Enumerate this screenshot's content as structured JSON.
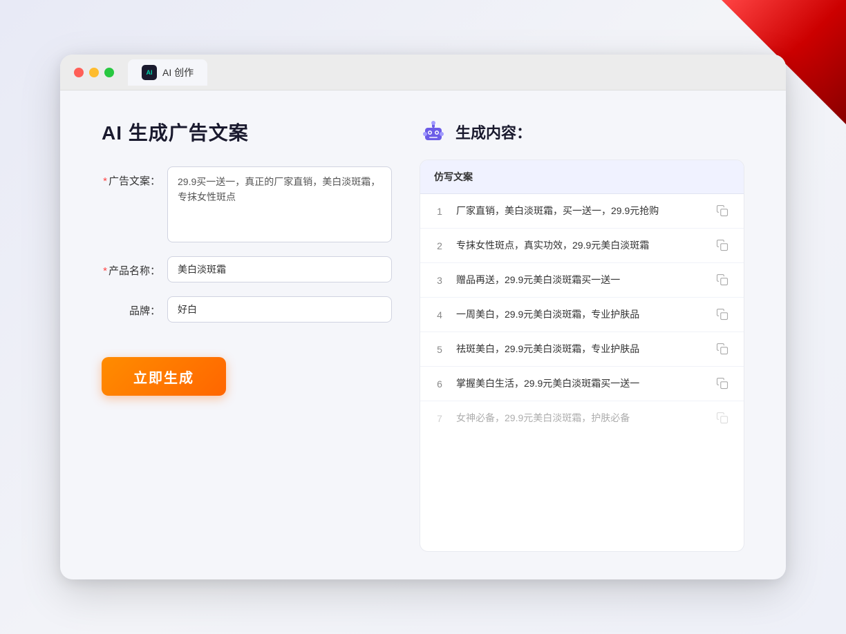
{
  "window": {
    "tab_label": "AI 创作",
    "ai_icon_text": "AI"
  },
  "left_panel": {
    "title": "AI 生成广告文案",
    "form": {
      "ad_copy_label": "广告文案：",
      "ad_copy_required": "*",
      "ad_copy_value": "29.9买一送一，真正的厂家直销，美白淡斑霜，专抹女性斑点",
      "product_name_label": "产品名称：",
      "product_name_required": "*",
      "product_name_value": "美白淡斑霜",
      "brand_label": "品牌：",
      "brand_value": "好白"
    },
    "generate_button": "立即生成"
  },
  "right_panel": {
    "title": "生成内容：",
    "table_header": "仿写文案",
    "results": [
      {
        "id": 1,
        "text": "厂家直销，美白淡斑霜，买一送一，29.9元抢购",
        "faded": false
      },
      {
        "id": 2,
        "text": "专抹女性斑点，真实功效，29.9元美白淡斑霜",
        "faded": false
      },
      {
        "id": 3,
        "text": "赠品再送，29.9元美白淡斑霜买一送一",
        "faded": false
      },
      {
        "id": 4,
        "text": "一周美白，29.9元美白淡斑霜，专业护肤品",
        "faded": false
      },
      {
        "id": 5,
        "text": "祛斑美白，29.9元美白淡斑霜，专业护肤品",
        "faded": false
      },
      {
        "id": 6,
        "text": "掌握美白生活，29.9元美白淡斑霜买一送一",
        "faded": false
      },
      {
        "id": 7,
        "text": "女神必备，29.9元美白淡斑霜，护肤必备",
        "faded": true
      }
    ]
  },
  "colors": {
    "accent_orange": "#ff6600",
    "accent_blue": "#5b6af0",
    "required_red": "#ff4444"
  }
}
